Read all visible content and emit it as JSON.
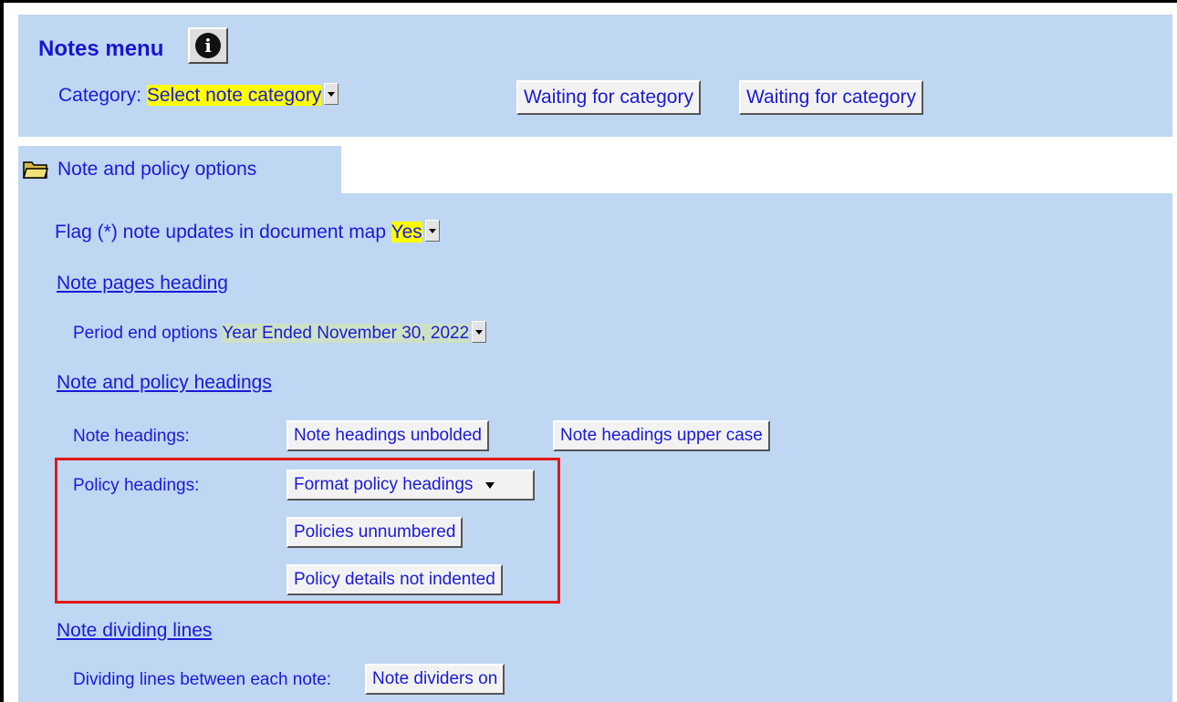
{
  "header": {
    "title": "Notes menu",
    "category_label": "Category:",
    "category_value": "Select note category",
    "waiting_button_1": "Waiting for category",
    "waiting_button_2": "Waiting for category"
  },
  "tab": {
    "label": "Note and policy options",
    "icon": "folder-icon"
  },
  "options": {
    "flag_label": "Flag (*) note updates in document map",
    "flag_value": "Yes",
    "note_pages_heading_link": "Note pages heading",
    "period_end_label": "Period end options",
    "period_end_value": "Year Ended November 30, 2022",
    "note_policy_headings_link": "Note and policy headings",
    "note_headings_label": "Note headings:",
    "note_headings_unbolded": "Note headings unbolded",
    "note_headings_upper_case": "Note headings upper case",
    "policy_headings_label": "Policy headings:",
    "format_policy_headings": "Format policy headings",
    "policies_unnumbered": "Policies unnumbered",
    "policy_details_not_indented": "Policy details not indented",
    "note_dividing_lines_link": "Note dividing lines",
    "dividing_lines_label": "Dividing lines between each note:",
    "note_dividers_on": "Note dividers on"
  },
  "colors": {
    "panel_background": "#bfd7f2",
    "text_blue": "#1a1ad8",
    "highlight_yellow": "#ffff00",
    "highlight_green": "#cde1c6",
    "annotation_red": "#e01818"
  }
}
